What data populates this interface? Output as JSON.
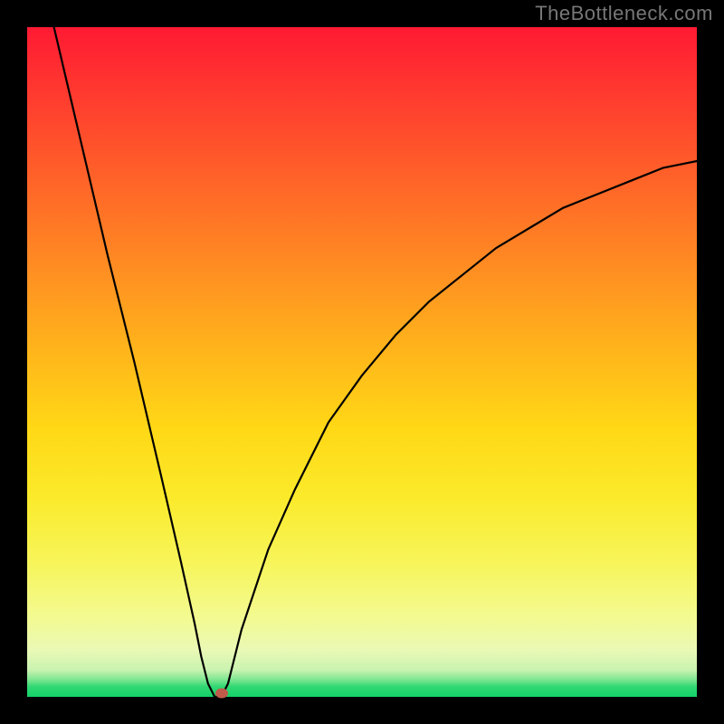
{
  "watermark": "TheBottleneck.com",
  "colors": {
    "page_bg": "#000000",
    "gradient_top": "#ff1a33",
    "gradient_mid": "#ffd816",
    "gradient_bottom": "#14d169",
    "curve_stroke": "#000000",
    "marker_fill": "#c05a4a",
    "watermark_text": "#777777"
  },
  "chart_data": {
    "type": "line",
    "title": "",
    "xlabel": "",
    "ylabel": "",
    "xlim": [
      0,
      100
    ],
    "ylim": [
      0,
      100
    ],
    "grid": false,
    "legend": false,
    "notes": "V-shaped bottleneck-style curve. x is the horizontal position (0=left,100=right). y is percent of vertical height above the baseline (0=bottom green edge, 100=top). Minimum of curve at x≈28 where y≈0. Curve rises steeply to the left (reaches top at x≈4) and rises more gradually and with decreasing slope to the right (reaches ≈80 at x=100).",
    "series": [
      {
        "name": "curve",
        "x": [
          4,
          8,
          12,
          16,
          20,
          23,
          25,
          26,
          27,
          28,
          29,
          30,
          32,
          36,
          40,
          45,
          50,
          55,
          60,
          65,
          70,
          75,
          80,
          85,
          90,
          95,
          100
        ],
        "y": [
          100,
          83,
          66,
          50,
          33,
          20,
          11,
          6,
          2,
          0,
          0,
          2,
          10,
          22,
          31,
          41,
          48,
          54,
          59,
          63,
          67,
          70,
          73,
          75,
          77,
          79,
          80
        ]
      }
    ],
    "marker": {
      "x": 29,
      "y": 0.5,
      "name": "optimal-point"
    }
  }
}
